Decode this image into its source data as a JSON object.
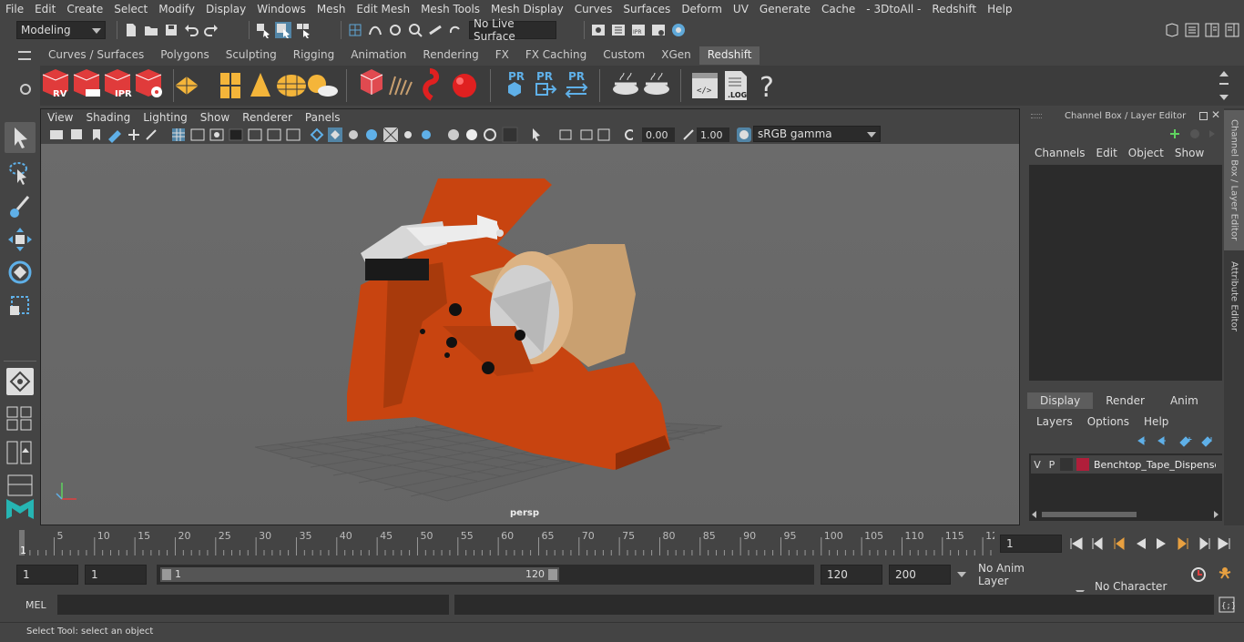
{
  "menu": [
    "File",
    "Edit",
    "Create",
    "Select",
    "Modify",
    "Display",
    "Windows",
    "Mesh",
    "Edit Mesh",
    "Mesh Tools",
    "Mesh Display",
    "Curves",
    "Surfaces",
    "Deform",
    "UV",
    "Generate",
    "Cache",
    "- 3DtoAll -",
    "Redshift",
    "Help"
  ],
  "status": {
    "mode": "Modeling",
    "live_surface": "No Live Surface"
  },
  "shelf_tabs": [
    "Curves / Surfaces",
    "Polygons",
    "Sculpting",
    "Rigging",
    "Animation",
    "Rendering",
    "FX",
    "FX Caching",
    "Custom",
    "XGen",
    "Redshift"
  ],
  "shelf_active": "Redshift",
  "shelf_icons": {
    "rv": "RV",
    "ipr": "IPR",
    "pr1": "PR",
    "pr2": "PR",
    "pr3": "PR",
    "log": ".LOG",
    "help": "?"
  },
  "viewport": {
    "menu": [
      "View",
      "Shading",
      "Lighting",
      "Show",
      "Renderer",
      "Panels"
    ],
    "exposure": "0.00",
    "gamma": "1.00",
    "colorspace": "sRGB gamma",
    "camera": "persp"
  },
  "channel_box": {
    "title": "Channel Box / Layer Editor",
    "menu": [
      "Channels",
      "Edit",
      "Object",
      "Show"
    ],
    "tabs": [
      "Display",
      "Render",
      "Anim"
    ],
    "layer_menu": [
      "Layers",
      "Options",
      "Help"
    ],
    "layer": {
      "v": "V",
      "p": "P",
      "name": "Benchtop_Tape_Dispenser",
      "color": "#b01e3a"
    }
  },
  "side_tabs": [
    "Channel Box / Layer Editor",
    "Attribute Editor"
  ],
  "timeline": {
    "ticks": [
      "5",
      "10",
      "15",
      "20",
      "25",
      "30",
      "35",
      "40",
      "45",
      "50",
      "55",
      "60",
      "65",
      "70",
      "75",
      "80",
      "85",
      "90",
      "95",
      "100",
      "105",
      "110",
      "115",
      "12"
    ],
    "start_marker": "1",
    "current_frame": "1"
  },
  "range": {
    "start": "1",
    "playback_start": "1",
    "slider_start": "1",
    "slider_end": "120",
    "playback_end": "120",
    "end": "200",
    "anim_layer": "No Anim Layer",
    "char_set": "No Character Set"
  },
  "mel_label": "MEL",
  "help_text": "Select Tool: select an object",
  "colors": {
    "accent": "#5285a6",
    "object": "#cc4a10",
    "tape": "#c9a070"
  }
}
